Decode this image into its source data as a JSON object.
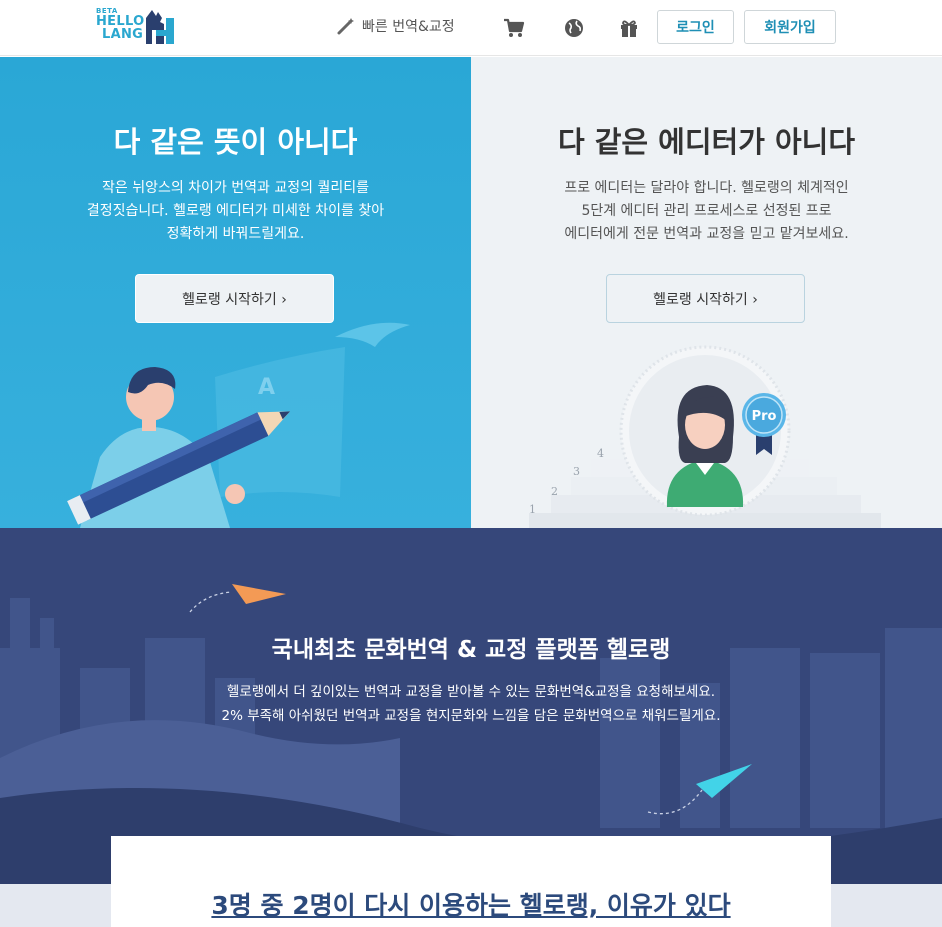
{
  "header": {
    "logo": {
      "beta": "BETA",
      "line1": "HELLO",
      "line2": "LANG"
    },
    "nav_translate": "빠른 번역&교정",
    "icons": [
      "magic-wand-icon",
      "cart-icon",
      "globe-icon",
      "gift-icon"
    ],
    "login": "로그인",
    "signup": "회원가입"
  },
  "hero_left": {
    "title": "다 같은 뜻이 아니다",
    "desc": [
      "작은 뉘앙스의 차이가 번역과 교정의 퀄리티를",
      "결정짓습니다. 헬로랭 에디터가 미세한 차이를 찾아",
      "정확하게 바꿔드릴게요."
    ],
    "button": "헬로랭 시작하기 ›",
    "illustration_letter": "A"
  },
  "hero_right": {
    "title": "다 같은 에디터가 아니다",
    "desc": [
      "프로 에디터는 달라야 합니다. 헬로랭의 체계적인",
      "5단계 에디터 관리 프로세스로 선정된 프로",
      "에디터에게 전문 번역과 교정을 믿고 맡겨보세요."
    ],
    "button": "헬로랭 시작하기 ›",
    "badge": "Pro",
    "steps": [
      "1",
      "2",
      "3",
      "4"
    ]
  },
  "band": {
    "title": "국내최초 문화번역 & 교정 플랫폼 헬로랭",
    "desc": [
      "헬로랭에서 더 깊이있는 번역과 교정을 받아볼 수 있는 문화번역&교정을 요청해보세요.",
      "2% 부족해 아쉬웠던 번역과 교정을 현지문화와 느낌을 담은 문화번역으로 채워드릴게요."
    ]
  },
  "card": {
    "title": "3명 중 2명이 다시 이용하는 헬로랭, 이유가 있다"
  },
  "colors": {
    "accent": "#2aa7d6",
    "band": "#36477a",
    "link": "#2c4a7c"
  }
}
